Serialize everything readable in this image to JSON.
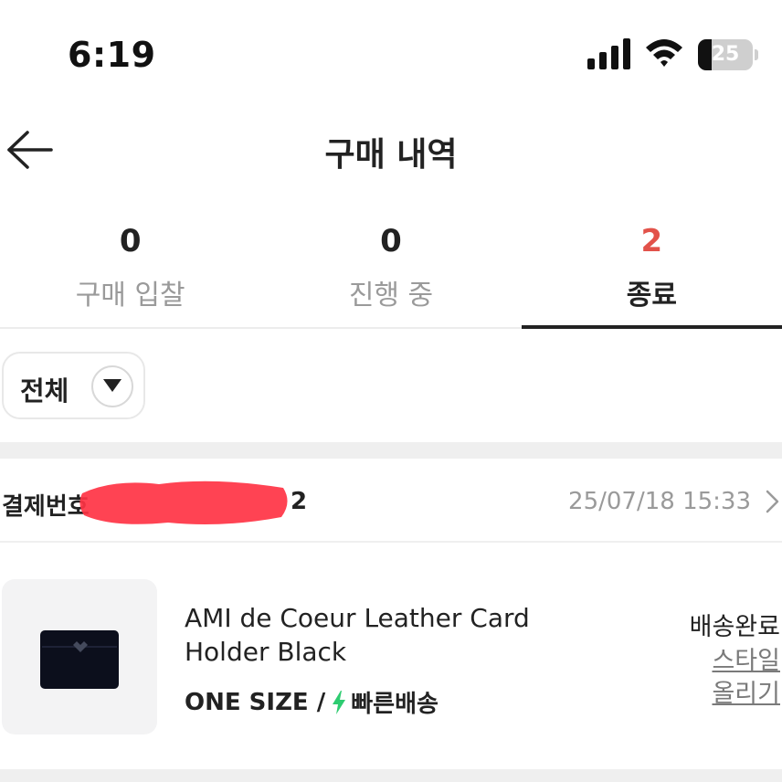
{
  "status_bar": {
    "time": "6:19",
    "battery_level": "25",
    "battery_fraction": 0.25
  },
  "header": {
    "title": "구매 내역"
  },
  "tabs": [
    {
      "count": "0",
      "label": "구매 입찰",
      "active": false
    },
    {
      "count": "0",
      "label": "진행 중",
      "active": false
    },
    {
      "count": "2",
      "label": "종료",
      "active": true
    }
  ],
  "filter": {
    "label": "전체"
  },
  "order": {
    "number_label": "결제번호",
    "number_suffix": "2",
    "date": "25/07/18 15:33"
  },
  "product": {
    "name": "AMI de Coeur Leather Card Holder Black",
    "size": "ONE SIZE /",
    "shipping": "빠른배송",
    "status": "배송완료",
    "style_link": "스타일 올리기"
  },
  "colors": {
    "accent": "#e2524a",
    "shipping_bolt": "#2ecc71",
    "redaction": "#ff3344"
  }
}
